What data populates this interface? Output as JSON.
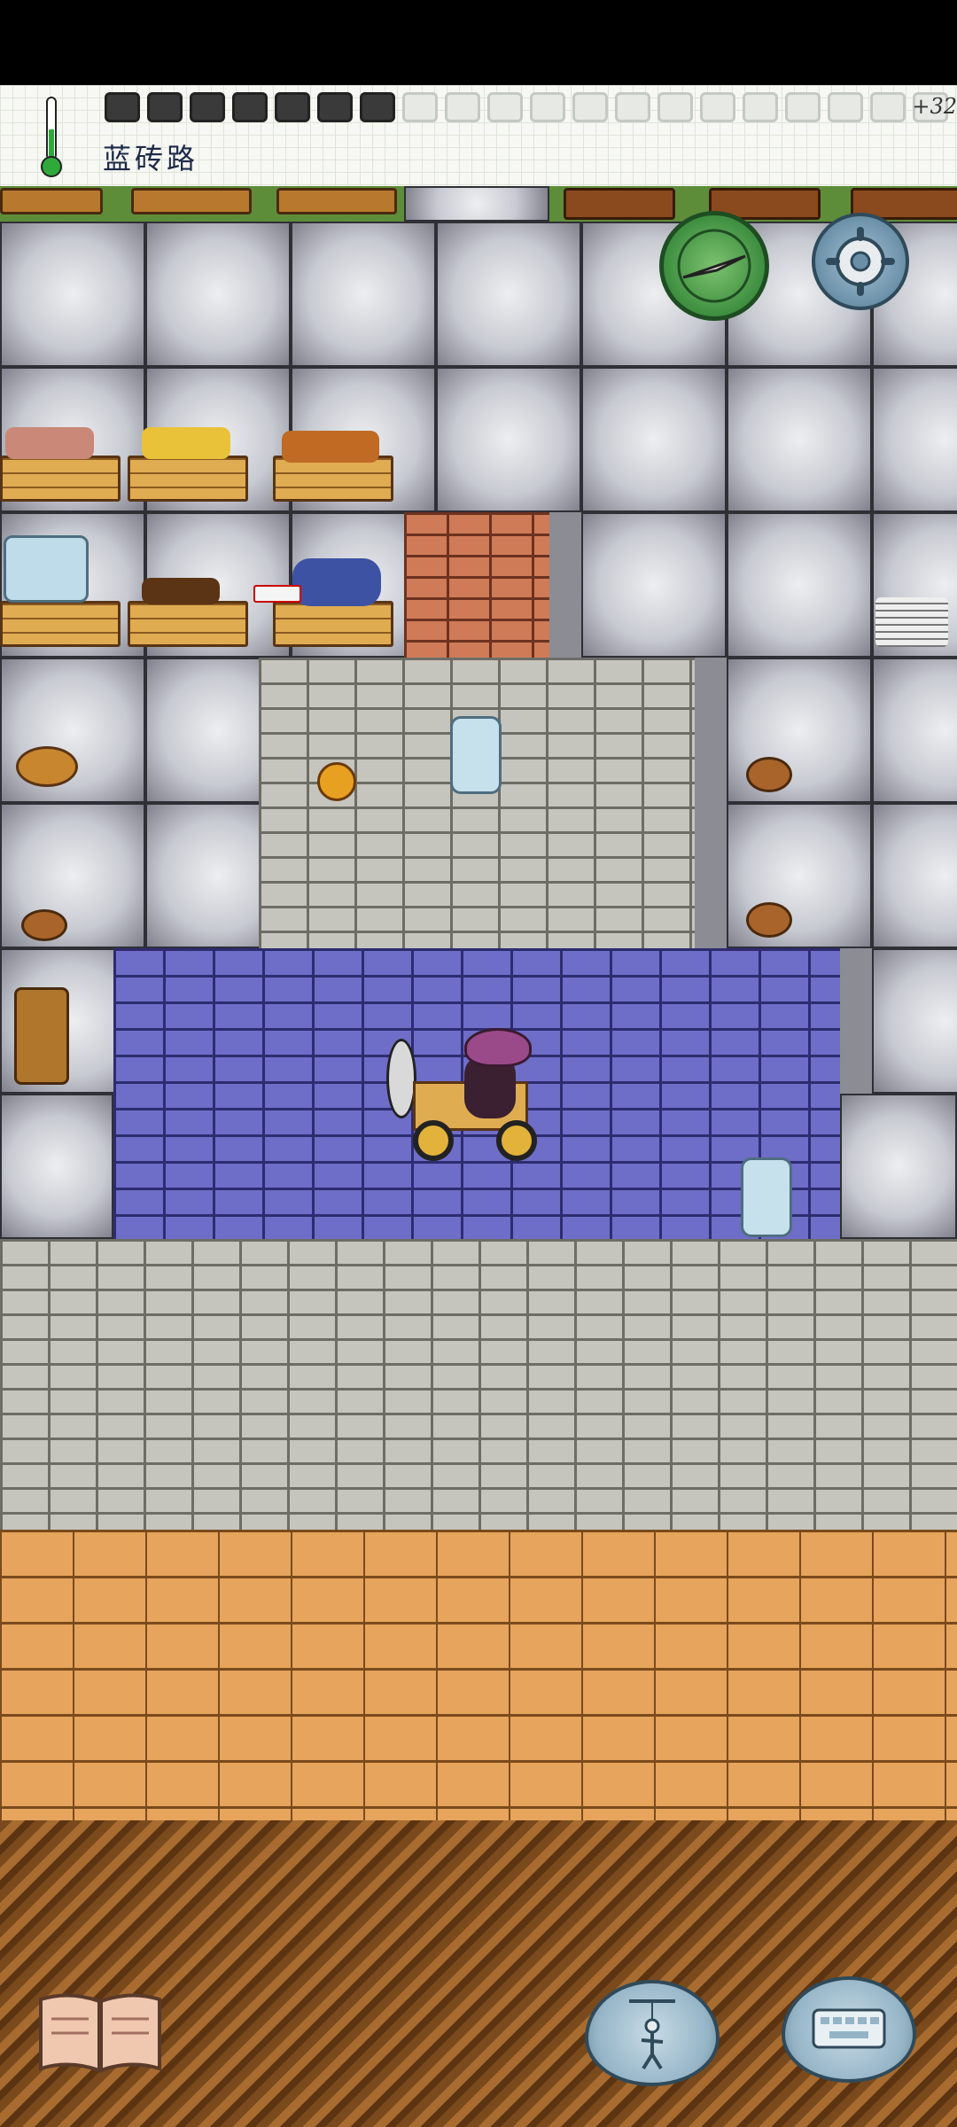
{
  "hud": {
    "location_name": "蓝砖路",
    "yum_bonus": "+32",
    "hunger": {
      "filled": 7,
      "total": 20
    },
    "thermometer_icon": "thermometer-icon"
  },
  "buttons": {
    "compass_icon": "compass-icon",
    "settings_icon": "gear-icon",
    "tech_tree_icon": "book-icon",
    "emote_icon": "puppet-icon",
    "chat_icon": "keyboard-icon"
  },
  "colors": {
    "blue_brick": "#6e6dc8",
    "grey_brick": "#c5c5be",
    "red_brick": "#cf7b58",
    "wood_floor": "#e6a45c",
    "compass_green": "#3e8e40",
    "settings_blue": "#6a90a8"
  }
}
